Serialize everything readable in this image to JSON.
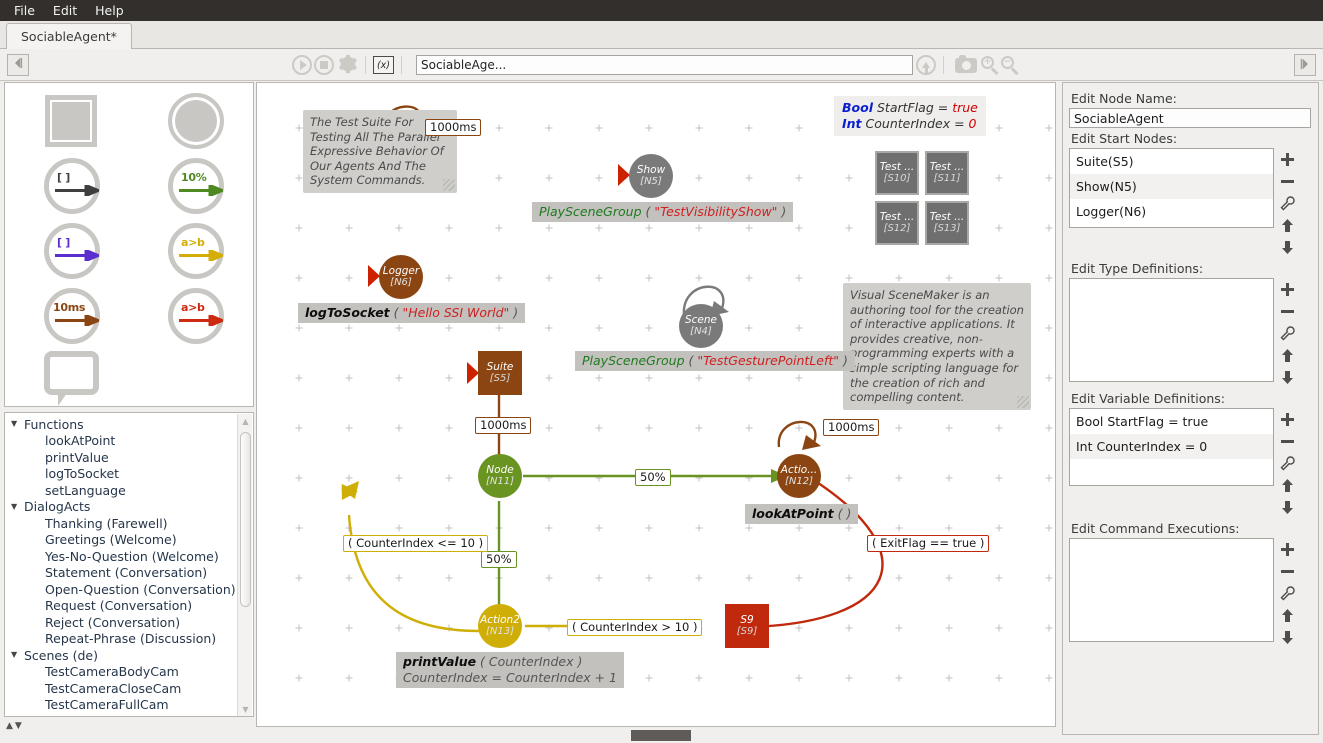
{
  "menu": {
    "items": [
      "File",
      "Edit",
      "Help"
    ]
  },
  "tab": {
    "label": "SociableAgent*"
  },
  "toolbar": {
    "back_icon": "left-arrow-icon",
    "play_icon": "play-icon",
    "stop_icon": "stop-icon",
    "settings_icon": "gear-icon",
    "variables_label": "(x)",
    "path_value": "SociableAge...",
    "up_icon": "up-arrow-icon",
    "screenshot_icon": "camera-icon",
    "zoom_in_icon": "zoom-in-icon",
    "zoom_out_icon": "zoom-out-icon",
    "forward_icon": "right-arrow-icon"
  },
  "palette": {
    "items": [
      {
        "name": "supernode-shape",
        "kind": "square",
        "label": ""
      },
      {
        "name": "basicnode-shape",
        "kind": "circle",
        "label": ""
      },
      {
        "name": "epsilon-edge",
        "kind": "arrow",
        "label": "[   ]",
        "color": "#4a4a4a"
      },
      {
        "name": "probability-edge",
        "kind": "arrow",
        "label": "10%",
        "color": "#4e8a21"
      },
      {
        "name": "fork-edge",
        "kind": "arrow",
        "label": "[   ]",
        "color": "#5b2fcf"
      },
      {
        "name": "conditional-edge",
        "kind": "arrow",
        "label": "a>b",
        "color": "#d4ae07"
      },
      {
        "name": "timeout-edge",
        "kind": "arrow",
        "label": "10ms",
        "color": "#8a4513"
      },
      {
        "name": "interruptive-edge",
        "kind": "arrow",
        "label": "a>b",
        "color": "#cc2a11"
      },
      {
        "name": "comment-shape",
        "kind": "bubble",
        "label": ""
      }
    ]
  },
  "tree": {
    "groups": [
      {
        "label": "Functions",
        "children": [
          "lookAtPoint",
          "printValue",
          "logToSocket",
          "setLanguage"
        ]
      },
      {
        "label": "DialogActs",
        "children": [
          "Thanking (Farewell)",
          "Greetings (Welcome)",
          "Yes-No-Question (Welcome)",
          "Statement (Conversation)",
          "Open-Question (Conversation)",
          "Request (Conversation)",
          "Reject (Conversation)",
          "Repeat-Phrase (Discussion)"
        ]
      },
      {
        "label": "Scenes (de)",
        "children": [
          "TestCameraBodyCam",
          "TestCameraCloseCam",
          "TestCameraFullCam"
        ]
      }
    ]
  },
  "inspector": {
    "node_name_label": "Edit Node Name:",
    "node_name_value": "SociableAgent",
    "start_nodes_label": "Edit Start Nodes:",
    "start_nodes": [
      "Suite(S5)",
      "Show(N5)",
      "Logger(N6)"
    ],
    "type_defs_label": "Edit Type Definitions:",
    "type_defs": [],
    "var_defs_label": "Edit Variable Definitions:",
    "var_defs": [
      "Bool StartFlag = true",
      "Int CounterIndex = 0"
    ],
    "cmd_exec_label": "Edit Command Executions:",
    "cmd_execs": [],
    "buttons": {
      "add": "add-icon",
      "remove": "remove-icon",
      "edit": "wrench-icon",
      "up": "move-up-icon",
      "down": "move-down-icon"
    }
  },
  "canvas": {
    "comments": [
      {
        "name": "comment-test-suite",
        "text": "The Test Suite For Testing All The Parallel Expressive Behavior Of Our Agents And The System Commands."
      },
      {
        "name": "comment-scenemaker",
        "text": "Visual SceneMaker is an authoring tool for the  creation of interactive applications.  It provides creative, non-programming experts with a simple scripting language for the creation of rich and compelling content."
      }
    ],
    "variable_box": {
      "name": "variable-display-box",
      "lines": [
        {
          "type": "Bool",
          "var": "StartFlag",
          "value": "true"
        },
        {
          "type": "Int",
          "var": "CounterIndex",
          "value": "0"
        }
      ]
    },
    "nodes": [
      {
        "name": "node-show",
        "label": "Show",
        "id": "[N5]",
        "shape": "circle",
        "color": "#7a7a7a",
        "start": true
      },
      {
        "name": "node-scene",
        "label": "Scene",
        "id": "[N4]",
        "shape": "circle",
        "color": "#7a7a7a",
        "start": false
      },
      {
        "name": "node-logger",
        "label": "Logger",
        "id": "[N6]",
        "shape": "circle",
        "color": "#8a4513",
        "start": true
      },
      {
        "name": "node-suite",
        "label": "Suite",
        "id": "[S5]",
        "shape": "square",
        "color": "#8a4513",
        "start": true
      },
      {
        "name": "node-n11",
        "label": "Node",
        "id": "[N11]",
        "shape": "circle",
        "color": "#6a9421",
        "start": false
      },
      {
        "name": "node-n12",
        "label": "Actio...",
        "id": "[N12]",
        "shape": "circle",
        "color": "#8a4513",
        "start": false
      },
      {
        "name": "node-action2",
        "label": "Action2",
        "id": "[N13]",
        "shape": "circle",
        "color": "#cfae07",
        "start": false
      },
      {
        "name": "node-s9",
        "label": "S9",
        "id": "[S9]",
        "shape": "square",
        "color": "#c0290c",
        "start": false
      },
      {
        "name": "node-s10",
        "label": "Test ...",
        "id": "[S10]",
        "shape": "square",
        "color": "#7a7a7a",
        "start": false
      },
      {
        "name": "node-s11",
        "label": "Test ...",
        "id": "[S11]",
        "shape": "square",
        "color": "#7a7a7a",
        "start": false
      },
      {
        "name": "node-s12",
        "label": "Test ...",
        "id": "[S12]",
        "shape": "square",
        "color": "#7a7a7a",
        "start": false
      },
      {
        "name": "node-s13",
        "label": "Test ...",
        "id": "[S13]",
        "shape": "square",
        "color": "#7a7a7a",
        "start": false
      }
    ],
    "commands": [
      {
        "name": "command-show",
        "fn": "PlaySceneGroup",
        "args": "\"TestVisibilityShow\"",
        "style": "scene"
      },
      {
        "name": "command-scene",
        "fn": "PlaySceneGroup",
        "args": "\"TestGesturePointLeft\"",
        "style": "scene"
      },
      {
        "name": "command-logger",
        "fn": "logToSocket",
        "args": "\"Hello SSI World\"",
        "style": "fn"
      },
      {
        "name": "command-n12",
        "fn": "lookAtPoint",
        "args": "",
        "style": "fn"
      },
      {
        "name": "command-action2-1",
        "fn": "printValue",
        "args": "CounterIndex",
        "style": "fn"
      },
      {
        "name": "command-action2-2",
        "fn": "CounterIndex = CounterIndex + 1",
        "args": "",
        "style": "assign"
      }
    ],
    "edge_labels": [
      {
        "name": "edge-label-logger-timeout",
        "text": "1000ms",
        "color": "#8a4513"
      },
      {
        "name": "edge-label-suite-timeout",
        "text": "1000ms",
        "color": "#8a4513"
      },
      {
        "name": "edge-label-n12-timeout",
        "text": "1000ms",
        "color": "#8a4513"
      },
      {
        "name": "edge-label-prob-50-right",
        "text": "50%",
        "color": "#6a9421"
      },
      {
        "name": "edge-label-prob-50-down",
        "text": "50%",
        "color": "#6a9421"
      },
      {
        "name": "edge-label-cond-lte",
        "text": "( CounterIndex <= 10 )",
        "color": "#cfae07"
      },
      {
        "name": "edge-label-cond-gt",
        "text": "( CounterIndex > 10 )",
        "color": "#cfae07"
      },
      {
        "name": "edge-label-cond-exit",
        "text": "( ExitFlag == true )",
        "color": "#c0290c"
      }
    ]
  }
}
